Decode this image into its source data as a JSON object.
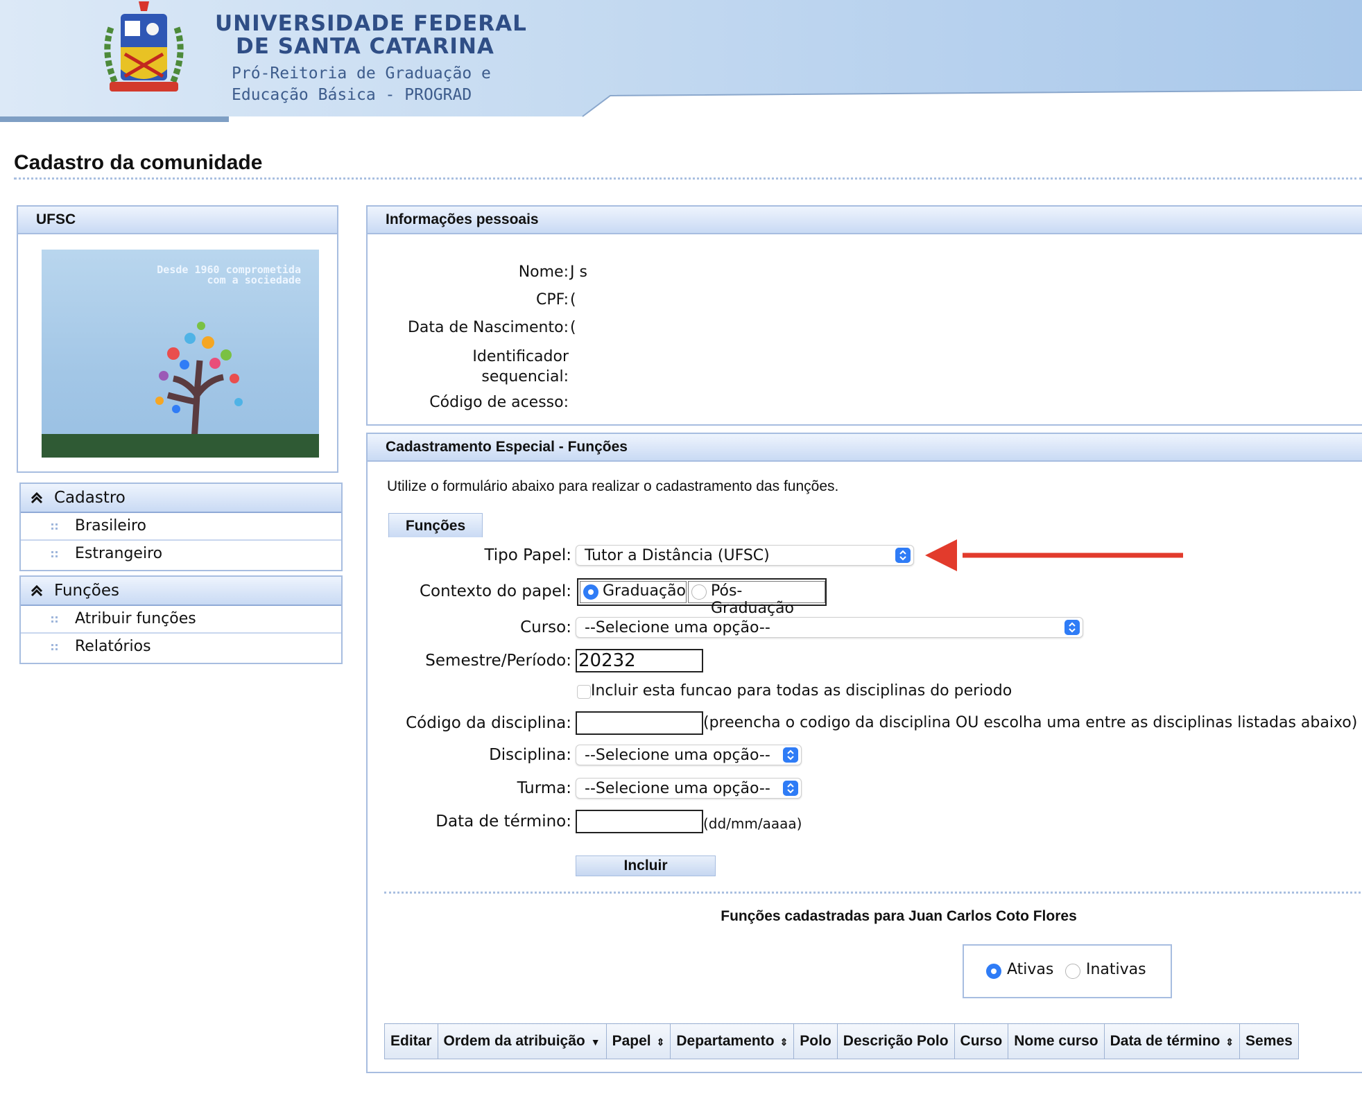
{
  "header": {
    "university_line1": "UNIVERSIDADE FEDERAL",
    "university_line2": "DE SANTA CATARINA",
    "sub_line1": "Pró-Reitoria de Graduação e",
    "sub_line2": "Educação Básica - PROGRAD"
  },
  "page_title": "Cadastro da comunidade",
  "ufsc_panel": {
    "title": "UFSC",
    "slogan_line1": "Desde 1960 comprometida",
    "slogan_line2": "com a sociedade"
  },
  "nav": {
    "cadastro": {
      "title": "Cadastro",
      "items": [
        "Brasileiro",
        "Estrangeiro"
      ]
    },
    "funcoes": {
      "title": "Funções",
      "items": [
        "Atribuir funções",
        "Relatórios"
      ]
    }
  },
  "info_panel": {
    "title": "Informações pessoais",
    "fields": [
      {
        "label": "Nome:",
        "value": "J            s"
      },
      {
        "label": "CPF:",
        "value": "("
      },
      {
        "label": "Data de Nascimento:",
        "value": "("
      },
      {
        "label": "Identificador sequencial:",
        "value": ""
      },
      {
        "label": "Código de acesso:",
        "value": ""
      }
    ]
  },
  "cad_panel": {
    "title": "Cadastramento Especial - Funções",
    "intro": "Utilize o formulário abaixo para realizar o cadastramento das funções.",
    "tab": "Funções",
    "tipo_papel_label": "Tipo Papel:",
    "tipo_papel_value": "Tutor a Distância (UFSC)",
    "contexto_label": "Contexto do papel:",
    "contexto_options": [
      "Graduação",
      "Pós-Graduação"
    ],
    "contexto_selected": "Graduação",
    "curso_label": "Curso:",
    "curso_value": "--Selecione uma opção--",
    "semestre_label": "Semestre/Período:",
    "semestre_value": "20232",
    "incluir_todas_label": "Incluir esta funcao para todas as disciplinas do periodo",
    "codigo_label": "Código da disciplina:",
    "codigo_hint": "(preencha o codigo da disciplina OU escolha uma entre as disciplinas listadas abaixo)",
    "disciplina_label": "Disciplina:",
    "disciplina_value": "--Selecione uma opção--",
    "turma_label": "Turma:",
    "turma_value": "--Selecione uma opção--",
    "data_termino_label": "Data de término:",
    "data_termino_hint": "(dd/mm/aaaa)",
    "incluir_button": "Incluir",
    "registered_title": "Funções cadastradas para Juan Carlos Coto Flores",
    "filter_options": [
      "Ativas",
      "Inativas"
    ],
    "filter_selected": "Ativas",
    "table_headers": [
      "Editar",
      "Ordem da atribuição",
      "Papel",
      "Departamento",
      "Polo",
      "Descrição Polo",
      "Curso",
      "Nome curso",
      "Data de término",
      "Semes"
    ]
  },
  "colors": {
    "accent_blue": "#2f7cf6",
    "panel_border": "#a7bde0",
    "annotation_arrow": "#e23b2c"
  }
}
